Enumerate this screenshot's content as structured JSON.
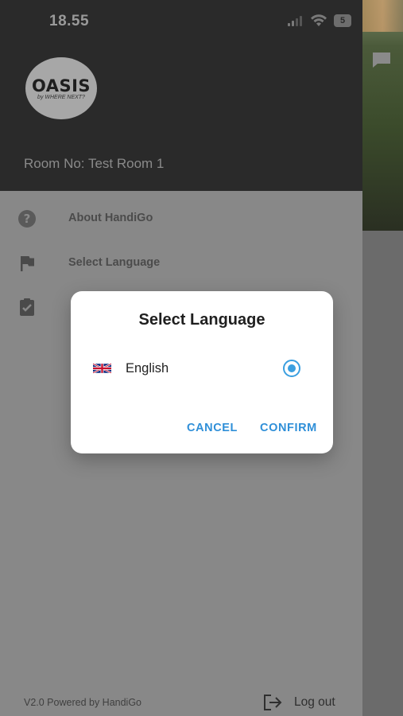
{
  "status_bar": {
    "time": "18.55",
    "battery": "5"
  },
  "drawer": {
    "logo": {
      "main_text": "OASIS",
      "sub_text": "by WHERE NEXT?"
    },
    "room_label": "Room No: Test Room 1",
    "menu": [
      {
        "label": "About HandiGo",
        "icon": "help-circle-icon"
      },
      {
        "label": "Select Language",
        "icon": "flag-icon"
      },
      {
        "label": "",
        "icon": "clipboard-check-icon"
      }
    ],
    "footer": {
      "version": "V2.0 Powered by HandiGo",
      "logout_label": "Log out"
    }
  },
  "dialog": {
    "title": "Select Language",
    "options": [
      {
        "label": "English",
        "flag": "uk-flag-icon",
        "selected": true
      }
    ],
    "cancel_label": "CANCEL",
    "confirm_label": "CONFIRM"
  },
  "colors": {
    "accent": "#2f8fd8",
    "drawer_header": "#2a2a2a",
    "scrim": "#888888"
  }
}
